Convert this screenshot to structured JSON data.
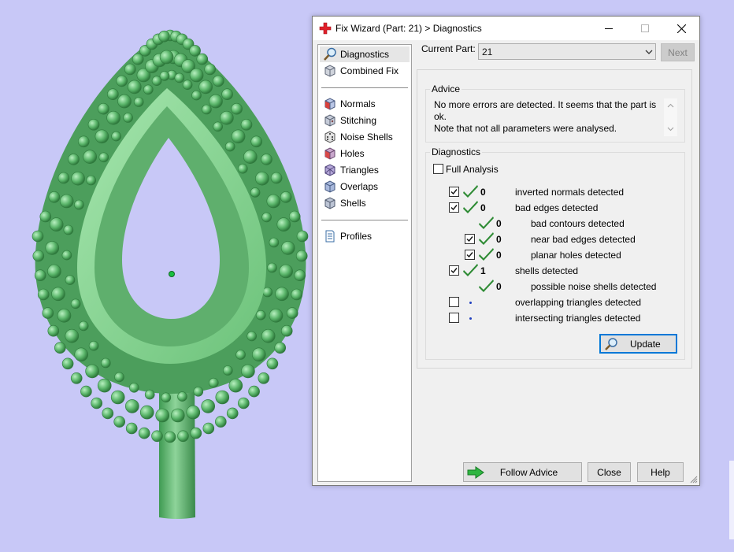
{
  "window": {
    "title": "Fix Wizard (Part: 21) > Diagnostics",
    "icon": "red-cross-icon"
  },
  "nav": {
    "items": [
      {
        "label": "Diagnostics",
        "icon": "magnifier-icon",
        "selected": true
      },
      {
        "label": "Combined Fix",
        "icon": "cube-icon"
      },
      {
        "label": "Normals",
        "icon": "normals-cube-icon"
      },
      {
        "label": "Stitching",
        "icon": "stitching-cube-icon"
      },
      {
        "label": "Noise Shells",
        "icon": "noise-dice-icon"
      },
      {
        "label": "Holes",
        "icon": "holes-cube-icon"
      },
      {
        "label": "Triangles",
        "icon": "triangles-cube-icon"
      },
      {
        "label": "Overlaps",
        "icon": "overlaps-cube-icon"
      },
      {
        "label": "Shells",
        "icon": "shells-cube-icon"
      },
      {
        "label": "Profiles",
        "icon": "document-icon"
      }
    ]
  },
  "part": {
    "label": "Current Part:",
    "value": "21",
    "next_label": "Next"
  },
  "advice": {
    "title": "Advice",
    "line1": "No more errors are detected. It seems that the part is ok.",
    "line2": "Note that not all parameters were analysed."
  },
  "diagnostics": {
    "title": "Diagnostics",
    "full_analysis_label": "Full Analysis",
    "full_analysis_checked": false,
    "rows": [
      {
        "checkbox": true,
        "checked": true,
        "status": "check",
        "count": "0",
        "label": "inverted normals detected",
        "indent": 0
      },
      {
        "checkbox": true,
        "checked": true,
        "status": "check",
        "count": "0",
        "label": "bad edges detected",
        "indent": 0
      },
      {
        "checkbox": false,
        "checked": false,
        "status": "check",
        "count": "0",
        "label": "bad contours detected",
        "indent": 1
      },
      {
        "checkbox": true,
        "checked": true,
        "status": "check",
        "count": "0",
        "label": "near bad edges detected",
        "indent": 1
      },
      {
        "checkbox": true,
        "checked": true,
        "status": "check",
        "count": "0",
        "label": "planar holes detected",
        "indent": 1
      },
      {
        "checkbox": true,
        "checked": true,
        "status": "check",
        "count": "1",
        "label": "shells detected",
        "indent": 0
      },
      {
        "checkbox": false,
        "checked": false,
        "status": "check",
        "count": "0",
        "label": "possible noise shells detected",
        "indent": 1
      },
      {
        "checkbox": true,
        "checked": false,
        "status": "dot",
        "count": "",
        "label": "overlapping triangles detected",
        "indent": 0
      },
      {
        "checkbox": true,
        "checked": false,
        "status": "dot",
        "count": "",
        "label": "intersecting triangles detected",
        "indent": 0
      }
    ],
    "update_label": "Update"
  },
  "footer": {
    "follow_advice": "Follow Advice",
    "close": "Close",
    "help": "Help"
  },
  "colors": {
    "background": "#c8c8f7",
    "model_green": "#6fbf7d",
    "check_green": "#2e8b34",
    "accent_blue": "#0078d7"
  }
}
